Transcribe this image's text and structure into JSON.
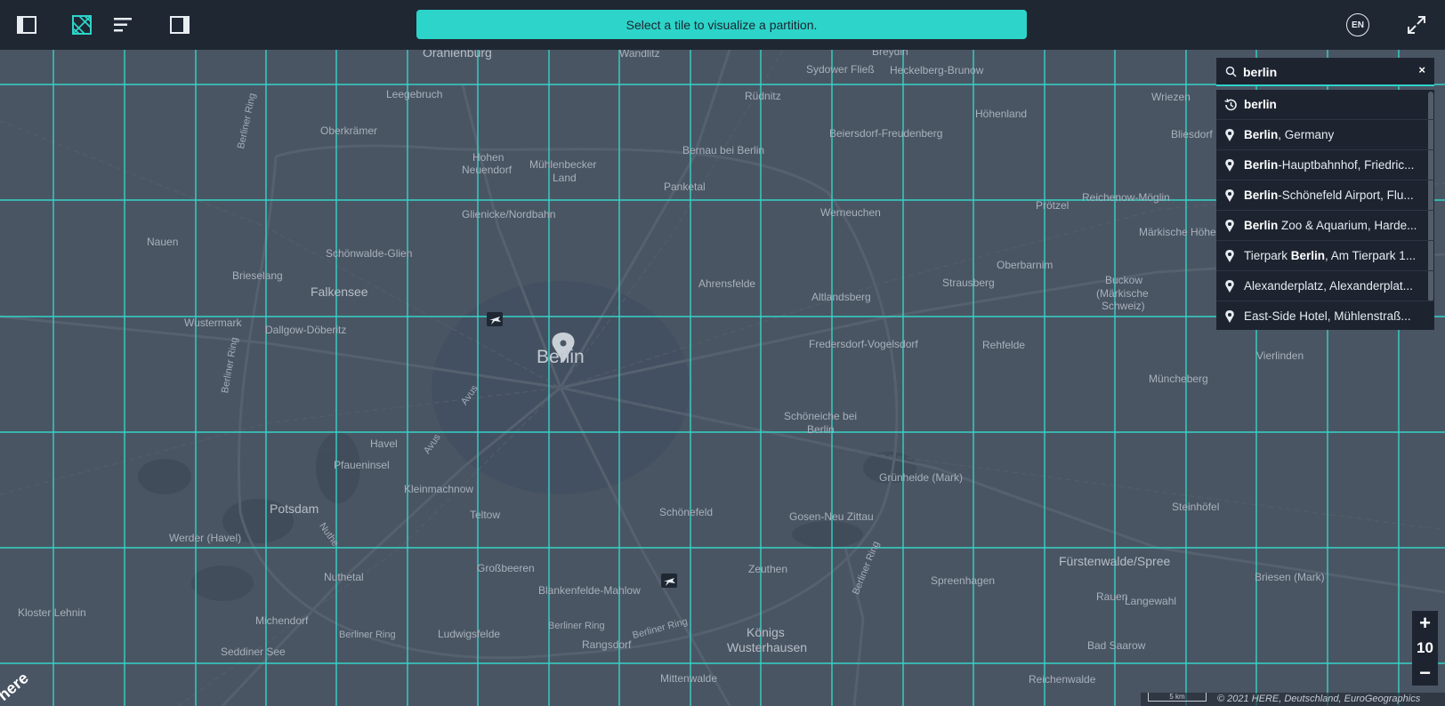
{
  "topbar": {
    "icons": [
      "sidebar-left-icon",
      "tile-grid-icon",
      "list-lines-icon",
      "sidebar-right-icon"
    ],
    "banner": "Select a tile to visualize a partition.",
    "language": "EN",
    "fullscreen_icon": "expand-icon"
  },
  "colors": {
    "accent": "#2dd4c9",
    "bar": "#1f2733",
    "map": "#4a5563",
    "panel": "#1d2430"
  },
  "search": {
    "value": "berlin",
    "clear": "×",
    "results": [
      {
        "icon": "history-icon",
        "bold": "berlin",
        "rest": ""
      },
      {
        "icon": "place-pin-icon",
        "bold": "Berlin",
        "rest": ", Germany"
      },
      {
        "icon": "place-pin-icon",
        "bold": "Berlin",
        "rest": "-Hauptbahnhof, Friedric..."
      },
      {
        "icon": "place-pin-icon",
        "bold": "Berlin",
        "rest": "-Schönefeld Airport, Flu..."
      },
      {
        "icon": "place-pin-icon",
        "bold": "Berlin",
        "rest": " Zoo & Aquarium, Harde..."
      },
      {
        "icon": "place-pin-icon",
        "pre": "Tierpark ",
        "bold": "Berlin",
        "rest": ", Am Tierpark 1..."
      },
      {
        "icon": "place-pin-icon",
        "bold": "",
        "rest": "Alexanderplatz, Alexanderplat..."
      },
      {
        "icon": "place-pin-icon",
        "bold": "",
        "rest": "East-Side Hotel, Mühlenstraß..."
      }
    ]
  },
  "map": {
    "city": "Berlin",
    "places": {
      "oranienburg": "Oranienburg",
      "wandlitz": "Wandlitz",
      "breydin": "Breydin",
      "sydower_fliess": "Sydower Fließ",
      "heckelberg": "Heckelberg-Brunow",
      "leegebruch": "Leegebruch",
      "ruednitz": "Rüdnitz",
      "hoehenland": "Höhenland",
      "wriezen": "Wriezen",
      "oberkraemer": "Oberkrämer",
      "hohen_neuendorf_1": "Hohen",
      "hohen_neuendorf_2": "Neuendorf",
      "muehlenbecker_1": "Mühlenbecker",
      "muehlenbecker_2": "Land",
      "bernau": "Bernau bei Berlin",
      "beiersdorf": "Beiersdorf-Freudenberg",
      "bliesdorf": "Bliesdorf",
      "panketal": "Panketal",
      "reichenow": "Reichenow-Möglin",
      "proetzel": "Prötzel",
      "glienicke": "Glienicke/Nordbahn",
      "werneuchen": "Werneuchen",
      "nauen": "Nauen",
      "maerkische_hoehe": "Märkische Höhe",
      "schoenwalde": "Schönwalde-Glien",
      "oberbarnim": "Oberbarnim",
      "brieselang": "Brieselang",
      "strausberg": "Strausberg",
      "buckow_1": "Buckow",
      "buckow_2": "(Märkische",
      "buckow_3": "Schweiz)",
      "ahrensfelde": "Ahrensfelde",
      "falkensee": "Falkensee",
      "altlandsberg": "Altlandsberg",
      "wustermark": "Wustermark",
      "dallgow": "Dallgow-Döberitz",
      "fredersdorf": "Fredersdorf-Vogelsdorf",
      "rehfelde": "Rehfelde",
      "vierlinden": "Vierlinden",
      "muencheberg": "Müncheberg",
      "schoeneiche_1": "Schöneiche bei",
      "schoeneiche_2": "Berlin",
      "havel": "Havel",
      "pfaueninsel": "Pfaueninsel",
      "gruenheide": "Grünheide (Mark)",
      "kleinmachnow": "Kleinmachnow",
      "potsdam": "Potsdam",
      "teltow": "Teltow",
      "schoenefeld": "Schönefeld",
      "gosen": "Gosen-Neu Zittau",
      "steinhoefel": "Steinhöfel",
      "werder": "Werder (Havel)",
      "fuerstenwalde": "Fürstenwalde/Spree",
      "grossbeeren": "Großbeeren",
      "zeuthen": "Zeuthen",
      "nuthetal": "Nuthetal",
      "spreenhagen": "Spreenhagen",
      "briesen": "Briesen (Mark)",
      "blankenfelde": "Blankenfelde-Mahlow",
      "rauen": "Rauen",
      "langewahl": "Langewahl",
      "kloster_lehnin": "Kloster Lehnin",
      "michendorf": "Michendorf",
      "ludwigsfelde": "Ludwigsfelde",
      "rangsdorf": "Rangsdorf",
      "koenigs_1": "Königs",
      "koenigs_2": "Wusterhausen",
      "bad_saarow": "Bad Saarow",
      "seddiner_see": "Seddiner See",
      "mittenwalde": "Mittenwalde",
      "reichenwalde": "Reichenwalde"
    },
    "roads": {
      "ring_1": "Berliner Ring",
      "ring_2": "Berliner Ring",
      "ring_3": "Berliner Ring",
      "ring_4": "Berliner Ring",
      "ring_5": "Berliner Ring",
      "ring_6": "Berliner Ring",
      "avus_1": "Avus",
      "avus_2": "Avus",
      "nuthe": "Nuthe"
    }
  },
  "zoom": {
    "plus": "+",
    "level": "10",
    "minus": "−"
  },
  "footer": {
    "scale": "5 km",
    "copyright": "© 2021 HERE, Deutschland, EuroGeographics",
    "logo": "here"
  }
}
